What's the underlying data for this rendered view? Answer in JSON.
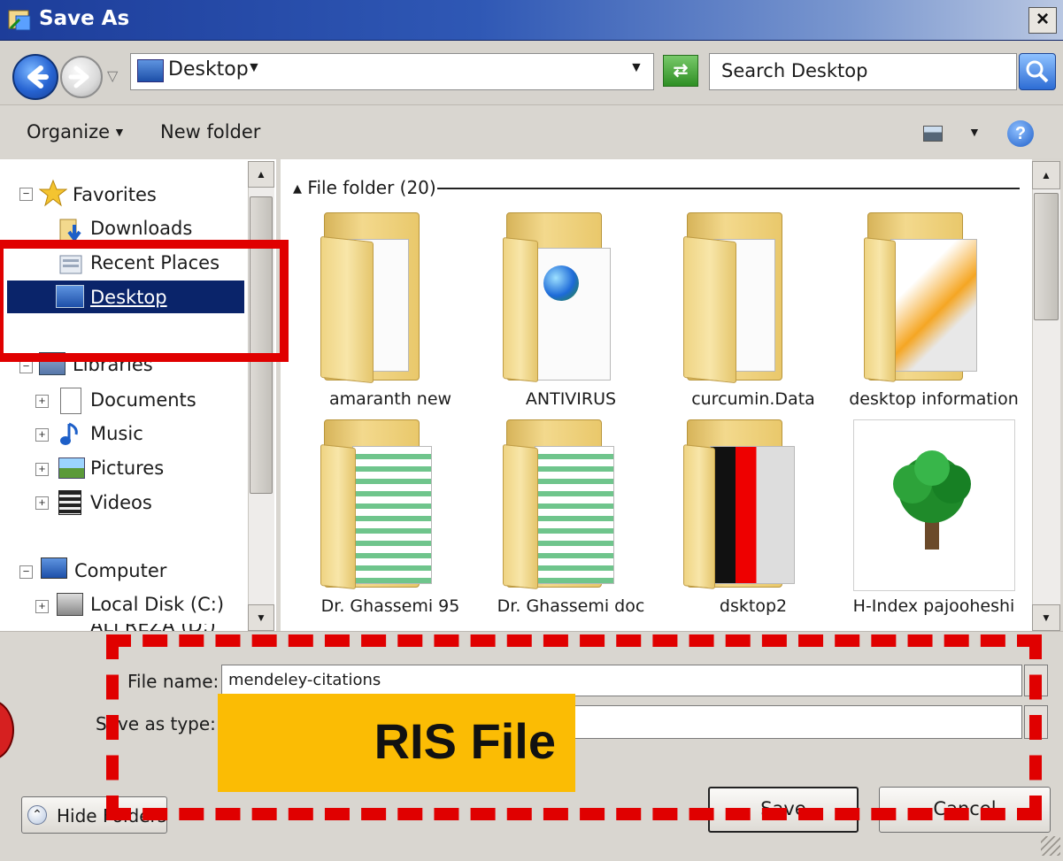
{
  "window": {
    "title": "Save As",
    "close_glyph": "×"
  },
  "address": {
    "location": "Desktop",
    "search_placeholder": "Search Desktop"
  },
  "toolbar": {
    "organize": "Organize",
    "new_folder": "New folder"
  },
  "nav": {
    "favorites": "Favorites",
    "downloads": "Downloads",
    "recent": "Recent Places",
    "desktop": "Desktop",
    "libraries": "Libraries",
    "documents": "Documents",
    "music": "Music",
    "pictures": "Pictures",
    "videos": "Videos",
    "computer": "Computer",
    "local_disk": "Local Disk (C:)",
    "next_drive": "ALI REZA (D:)"
  },
  "files": {
    "group_header": "File folder (20)",
    "items": [
      {
        "name": "amaranth new"
      },
      {
        "name": "ANTIVIRUS"
      },
      {
        "name": "curcumin.Data"
      },
      {
        "name": "desktop information"
      },
      {
        "name": "Dr. Ghassemi 95"
      },
      {
        "name": "Dr. Ghassemi doc"
      },
      {
        "name": "dsktop2"
      },
      {
        "name": "H-Index pajooheshi"
      }
    ]
  },
  "form": {
    "filename_label": "File name:",
    "filename_value": "mendeley-citations",
    "savetype_label": "Save as type:",
    "savetype_overlay": "RIS File"
  },
  "buttons": {
    "hide_folders": "Hide Folders",
    "save": "Save",
    "cancel": "Cancel"
  },
  "colors": {
    "annotation_red": "#e00000",
    "overlay_yellow": "#fbbc04",
    "selection_blue": "#0a246a"
  }
}
